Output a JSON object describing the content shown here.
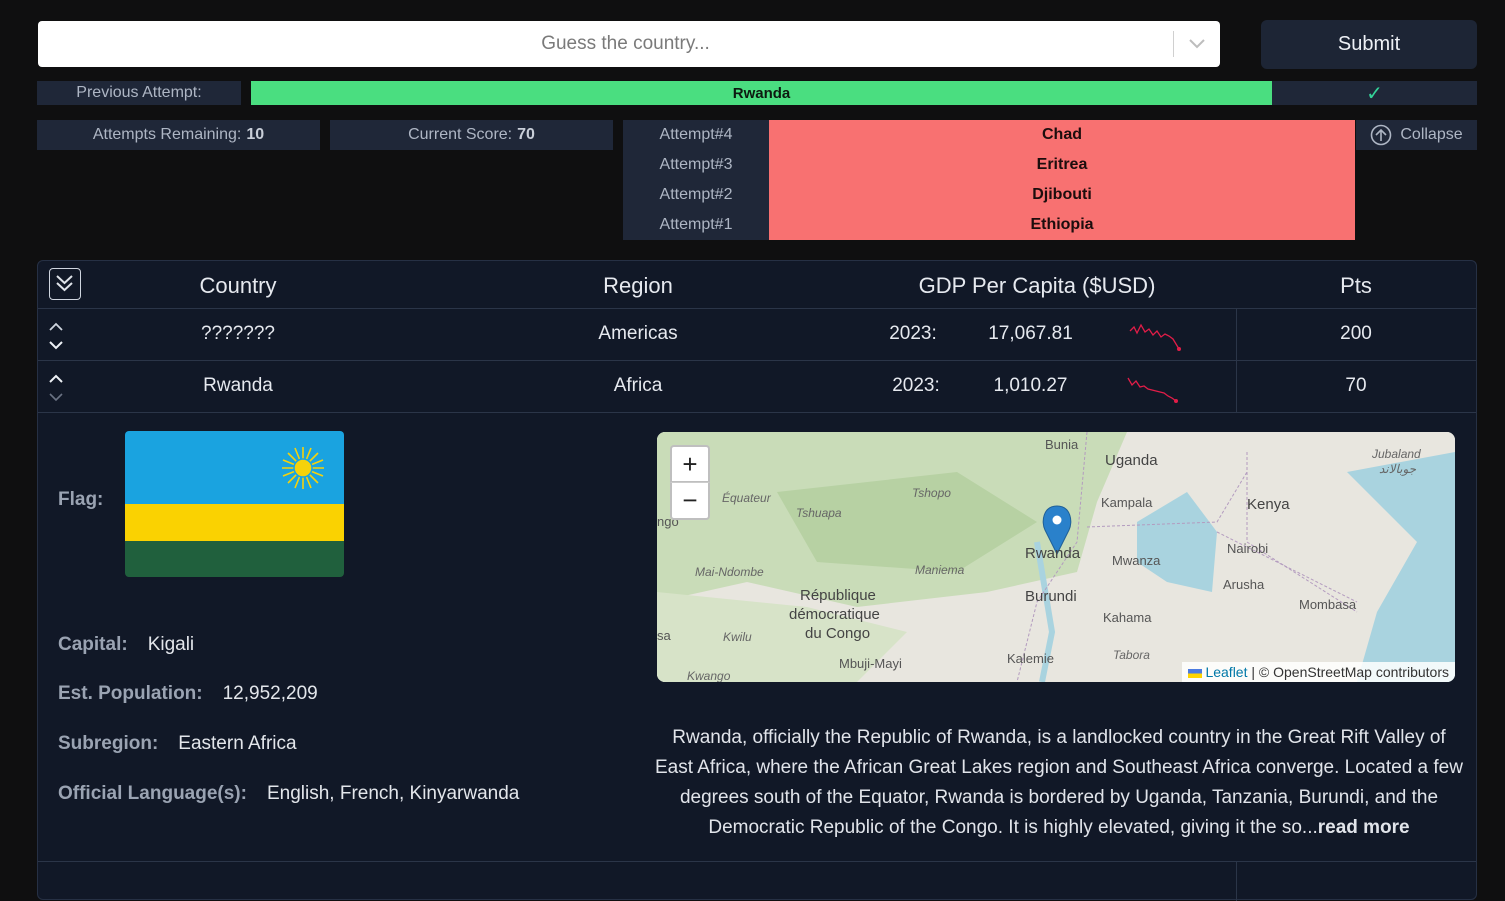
{
  "search": {
    "placeholder": "Guess the country..."
  },
  "submit_label": "Submit",
  "previous_attempt": {
    "label": "Previous Attempt:",
    "value": "Rwanda",
    "status": "✓"
  },
  "attempts_remaining": {
    "label": "Attempts Remaining:",
    "value": "10"
  },
  "current_score": {
    "label": "Current Score:",
    "value": "70"
  },
  "attempts": [
    {
      "label": "Attempt#4",
      "value": "Chad"
    },
    {
      "label": "Attempt#3",
      "value": "Eritrea"
    },
    {
      "label": "Attempt#2",
      "value": "Djibouti"
    },
    {
      "label": "Attempt#1",
      "value": "Ethiopia"
    }
  ],
  "collapse_label": "Collapse",
  "table": {
    "headers": {
      "country": "Country",
      "region": "Region",
      "gdp": "GDP Per Capita ($USD)",
      "pts": "Pts"
    },
    "rows": [
      {
        "country": "???????",
        "region": "Americas",
        "year": "2023:",
        "gdp": "17,067.81",
        "pts": "200"
      },
      {
        "country": "Rwanda",
        "region": "Africa",
        "year": "2023:",
        "gdp": "1,010.27",
        "pts": "70"
      }
    ]
  },
  "details": {
    "flag_label": "Flag:",
    "capital_label": "Capital:",
    "capital": "Kigali",
    "population_label": "Est. Population:",
    "population": "12,952,209",
    "subregion_label": "Subregion:",
    "subregion": "Eastern Africa",
    "languages_label": "Official Language(s):",
    "languages": "English, French, Kinyarwanda"
  },
  "map": {
    "zoom_in": "+",
    "zoom_out": "−",
    "attribution_leaflet": "Leaflet",
    "attribution_rest": " | © OpenStreetMap contributors",
    "labels": {
      "bunia": "Bunia",
      "uganda": "Uganda",
      "kampala": "Kampala",
      "kenya": "Kenya",
      "jubaland": "Jubaland",
      "jubaland_ar": "جوبالاند",
      "equateur": "Équateur",
      "tshopo": "Tshopo",
      "tshuapa": "Tshuapa",
      "ngo": "ngo",
      "rwanda": "Rwanda",
      "nairobi": "Nairobi",
      "mwanza": "Mwanza",
      "mai_ndombe": "Mai-Ndombe",
      "maniema": "Maniema",
      "republique": "République",
      "democratique": "démocratique",
      "du_congo": "du Congo",
      "burundi": "Burundi",
      "arusha": "Arusha",
      "mombasa": "Mombasa",
      "kahama": "Kahama",
      "kwilu": "Kwilu",
      "sa": "sa",
      "tabora": "Tabora",
      "kalemie": "Kalemie",
      "mbuji_mayi": "Mbuji-Mayi",
      "kwango": "Kwango"
    }
  },
  "description": {
    "text": "Rwanda, officially the Republic of Rwanda, is a landlocked country in the Great Rift Valley of East Africa, where the African Great Lakes region and Southeast Africa converge. Located a few degrees south of the Equator, Rwanda is bordered by Uganda, Tanzania, Burundi, and the Democratic Republic of the Congo. It is highly elevated, giving it the so...",
    "read_more": "read more"
  },
  "colors": {
    "correct": "#4ade80",
    "wrong": "#f87171",
    "panel": "#1f2738",
    "sparkline": "#e11d48"
  }
}
